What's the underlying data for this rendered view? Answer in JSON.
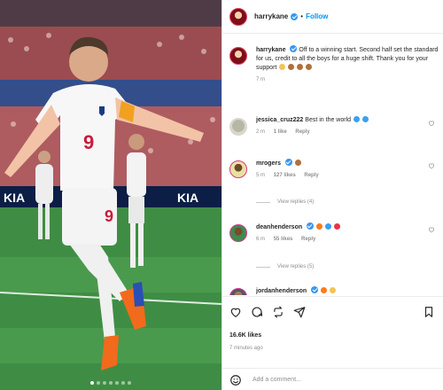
{
  "post": {
    "username": "harrykane",
    "follow_label": "Follow",
    "separator": "•",
    "likes": "16.6K likes",
    "time_ago": "7 minutes ago",
    "add_comment_placeholder": "Add a comment..."
  },
  "caption": {
    "username": "harrykane",
    "text": "Off to a winning start. Second half set the standard for us, credit to all the boys for a huge shift. Thank you for your support",
    "time": "7 m"
  },
  "comments": [
    {
      "username": "jessica_cruz222",
      "text": "Best in the world",
      "time": "2 m",
      "likes": "1 like",
      "reply": "Reply",
      "view_replies": ""
    },
    {
      "username": "mrogers",
      "text": "",
      "time": "5 m",
      "likes": "127 likes",
      "reply": "Reply",
      "view_replies": "View replies (4)"
    },
    {
      "username": "deanhenderson",
      "text": "",
      "time": "6 m",
      "likes": "55 likes",
      "reply": "Reply",
      "view_replies": "View replies (5)"
    },
    {
      "username": "jordanhenderson",
      "text": "",
      "time": "",
      "likes": "",
      "reply": "",
      "view_replies": ""
    }
  ],
  "photo": {
    "jersey_number": "9",
    "ad_boards": [
      "KIA",
      "KIA"
    ],
    "carousel_dots": 7,
    "active_dot": 0
  },
  "colors": {
    "accent_blue": "#0095f6",
    "verified_blue": "#3897f0",
    "text": "#262626",
    "muted": "#8e8e8e",
    "pitch_green": "#2f7a3a"
  },
  "icons": {
    "like": "heart-icon",
    "comment": "comment-icon",
    "share": "share-icon",
    "save": "bookmark-icon",
    "emoji": "smile-icon"
  }
}
